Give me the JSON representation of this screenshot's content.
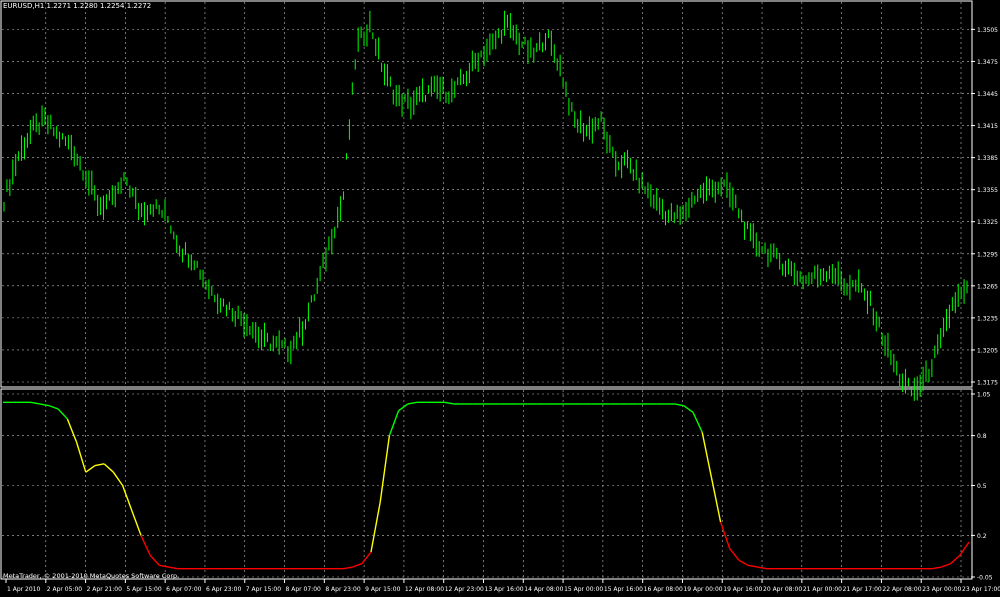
{
  "window": {
    "symbol_info": "EURUSD,H1  1.2271 1.2280 1.2254 1.2272",
    "indicator_info": "",
    "copyright": "MetaTrader, © 2001-2010 MetaQuotes Software Corp."
  },
  "colors": {
    "background": "#000000",
    "grid": "#c0c0c0",
    "price_candles": "#00ff00",
    "indicator_high": "#00ff00",
    "indicator_mid": "#ffff00",
    "indicator_low": "#ff0000",
    "axis_text": "#ffffff"
  },
  "chart_data": [
    {
      "type": "line",
      "title": "",
      "series": [
        {
          "values": [
            1.3345,
            1.3385,
            1.341,
            1.342,
            1.3405,
            1.3395,
            1.337,
            1.334,
            1.3345,
            1.3365,
            1.3335,
            1.334,
            1.333,
            1.33,
            1.329,
            1.3265,
            1.325,
            1.324,
            1.323,
            1.3215,
            1.321,
            1.3205,
            1.3225,
            1.326,
            1.3305,
            1.3345,
            1.349,
            1.351,
            1.3465,
            1.344,
            1.3435,
            1.3445,
            1.345,
            1.3445,
            1.346,
            1.348,
            1.349,
            1.351,
            1.3495,
            1.348,
            1.35,
            1.347,
            1.342,
            1.341,
            1.342,
            1.338,
            1.338,
            1.336,
            1.3345,
            1.333,
            1.333,
            1.335,
            1.3355,
            1.336,
            1.334,
            1.331,
            1.33,
            1.329,
            1.328,
            1.327,
            1.3275,
            1.328,
            1.3265,
            1.3265,
            1.3245,
            1.321,
            1.318,
            1.3165,
            1.318,
            1.321,
            1.325,
            1.326
          ]
        }
      ],
      "ylim": [
        1.3175,
        1.3525
      ],
      "y_ticks": [
        "1.3505",
        "1.3475",
        "1.3445",
        "1.3415",
        "1.3385",
        "1.3355",
        "1.3325",
        "1.3295",
        "1.3265",
        "1.3235",
        "1.3205",
        "1.3175"
      ],
      "x_ticks": [
        "1 Apr 2010",
        "2 Apr 05:00",
        "2 Apr 21:00",
        "5 Apr 15:00",
        "6 Apr 07:00",
        "6 Apr 23:00",
        "7 Apr 15:00",
        "8 Apr 07:00",
        "8 Apr 23:00",
        "9 Apr 15:00",
        "12 Apr 08:00",
        "12 Apr 23:00",
        "13 Apr 16:00",
        "14 Apr 08:00",
        "15 Apr 00:00",
        "15 Apr 16:00",
        "16 Apr 08:00",
        "19 Apr 00:00",
        "19 Apr 16:00",
        "20 Apr 08:00",
        "21 Apr 00:00",
        "21 Apr 17:00",
        "22 Apr 08:00",
        "23 Apr 00:00",
        "23 Apr 17:00"
      ],
      "grid": true
    },
    {
      "type": "line",
      "title": "",
      "series": [
        {
          "values": [
            1.0,
            1.0,
            1.0,
            1.0,
            0.99,
            0.98,
            0.96,
            0.9,
            0.76,
            0.58,
            0.62,
            0.63,
            0.58,
            0.5,
            0.35,
            0.2,
            0.08,
            0.02,
            0.01,
            0.0,
            0.0,
            0.0,
            0.0,
            0.0,
            0.0,
            0.0,
            0.0,
            0.0,
            0.0,
            0.0,
            0.0,
            0.0,
            0.0,
            0.0,
            0.0,
            0.0,
            0.0,
            0.0,
            0.01,
            0.03,
            0.1,
            0.4,
            0.8,
            0.95,
            0.99,
            1.0,
            1.0,
            1.0,
            1.0,
            0.99,
            0.99,
            0.99,
            0.99,
            0.99,
            0.99,
            0.99,
            0.99,
            0.99,
            0.99,
            0.99,
            0.99,
            0.99,
            0.99,
            0.99,
            0.99,
            0.99,
            0.99,
            0.99,
            0.99,
            0.99,
            0.99,
            0.99,
            0.99,
            0.99,
            0.98,
            0.94,
            0.82,
            0.55,
            0.28,
            0.12,
            0.05,
            0.02,
            0.01,
            0.0,
            0.0,
            0.0,
            0.0,
            0.0,
            0.0,
            0.0,
            0.0,
            0.0,
            0.0,
            0.0,
            0.0,
            0.0,
            0.0,
            0.0,
            0.0,
            0.0,
            0.0,
            0.0,
            0.01,
            0.03,
            0.08,
            0.16
          ]
        }
      ],
      "ylim": [
        -0.05,
        1.05
      ],
      "y_ticks": [
        "1.05",
        "0.8",
        "0.5",
        "0.2",
        "-0.05"
      ],
      "grid": true
    }
  ]
}
